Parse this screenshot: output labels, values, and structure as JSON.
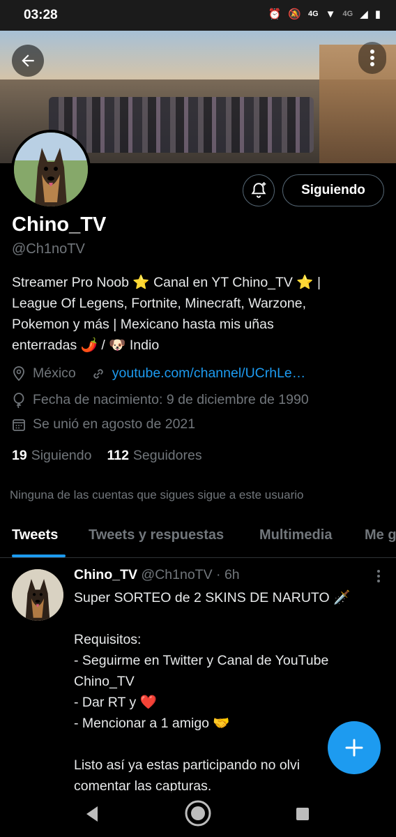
{
  "status_bar": {
    "time": "03:28",
    "net1": "4G",
    "net2": "4G"
  },
  "profile": {
    "display_name": "Chino_TV",
    "handle": "@Ch1noTV",
    "follow_button": "Siguiendo",
    "bio_lines": [
      "Streamer Pro Noob ⭐ Canal en YT Chino_TV  ⭐  |",
      "League Of Legens, Fortnite, Minecraft, Warzone,",
      "Pokemon y más | Mexicano hasta mis uñas",
      "enterradas 🌶️  / 🐶 Indio"
    ],
    "location": "México",
    "website": "youtube.com/channel/UCrhLe…",
    "birthday": "Fecha de nacimiento: 9 de diciembre de 1990",
    "joined": "Se unió en agosto de 2021",
    "following_count": "19",
    "following_label": "Siguiendo",
    "followers_count": "112",
    "followers_label": "Seguidores",
    "no_followers_note": "Ninguna de las cuentas que sigues sigue a este usuario"
  },
  "tabs": [
    "Tweets",
    "Tweets y respuestas",
    "Multimedia",
    "Me g"
  ],
  "tweet": {
    "name": "Chino_TV",
    "handle": "@Ch1noTV",
    "time": "· 6h",
    "lines": [
      "Super SORTEO de 2 SKINS DE NARUTO 🗡️",
      "",
      "Requisitos:",
      "- Seguirme en Twitter y Canal de YouTube",
      "Chino_TV",
      "- Dar RT y ❤️",
      "- Mencionar a 1 amigo 🤝",
      "",
      "Listo así ya estas participando no olvi",
      "comentar las capturas."
    ]
  },
  "colors": {
    "accent": "#1d9bf0",
    "background": "#000000",
    "muted": "#71767b"
  }
}
